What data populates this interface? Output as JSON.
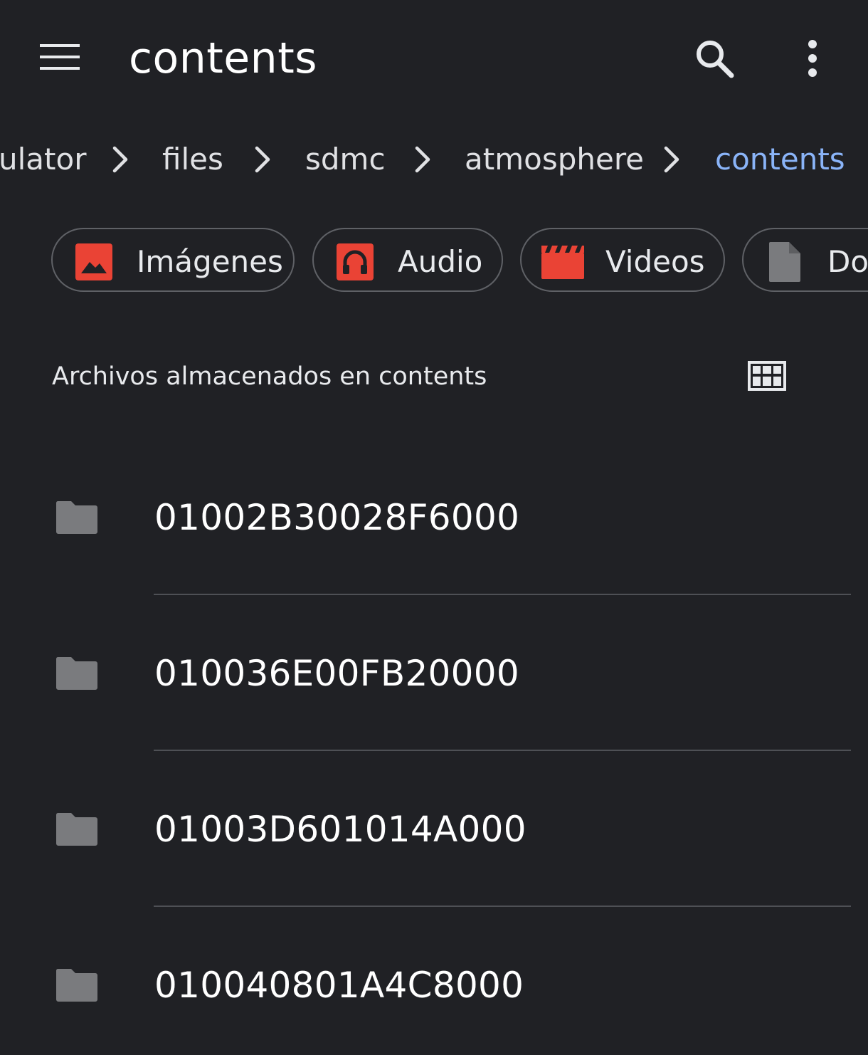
{
  "appbar": {
    "title": "contents",
    "icons": {
      "menu": "menu-icon",
      "search": "search-icon",
      "more": "more-vert-icon"
    }
  },
  "breadcrumb": {
    "items": [
      {
        "label": "ulator"
      },
      {
        "label": "files"
      },
      {
        "label": "sdmc"
      },
      {
        "label": "atmosphere"
      },
      {
        "label": "contents"
      }
    ]
  },
  "chips": [
    {
      "label": "Imágenes",
      "icon": "image-icon",
      "color": "#ea4335"
    },
    {
      "label": "Audio",
      "icon": "headphones-icon",
      "color": "#ea4335"
    },
    {
      "label": "Videos",
      "icon": "clapperboard-icon",
      "color": "#ea4335"
    },
    {
      "label": "Do",
      "icon": "document-icon",
      "color": "#7a7b7e"
    }
  ],
  "section": {
    "title": "Archivos almacenados en contents",
    "view_toggle_icon": "grid-view-icon"
  },
  "files": [
    {
      "name": "01002B30028F6000",
      "icon": "folder-icon"
    },
    {
      "name": "010036E00FB20000",
      "icon": "folder-icon"
    },
    {
      "name": "01003D601014A000",
      "icon": "folder-icon"
    },
    {
      "name": "010040801A4C8000",
      "icon": "folder-icon"
    }
  ],
  "colors": {
    "background": "#202125",
    "accent": "#8ab4f8",
    "chip_icon_red": "#ea4335",
    "folder_gray": "#7a7b7e"
  }
}
